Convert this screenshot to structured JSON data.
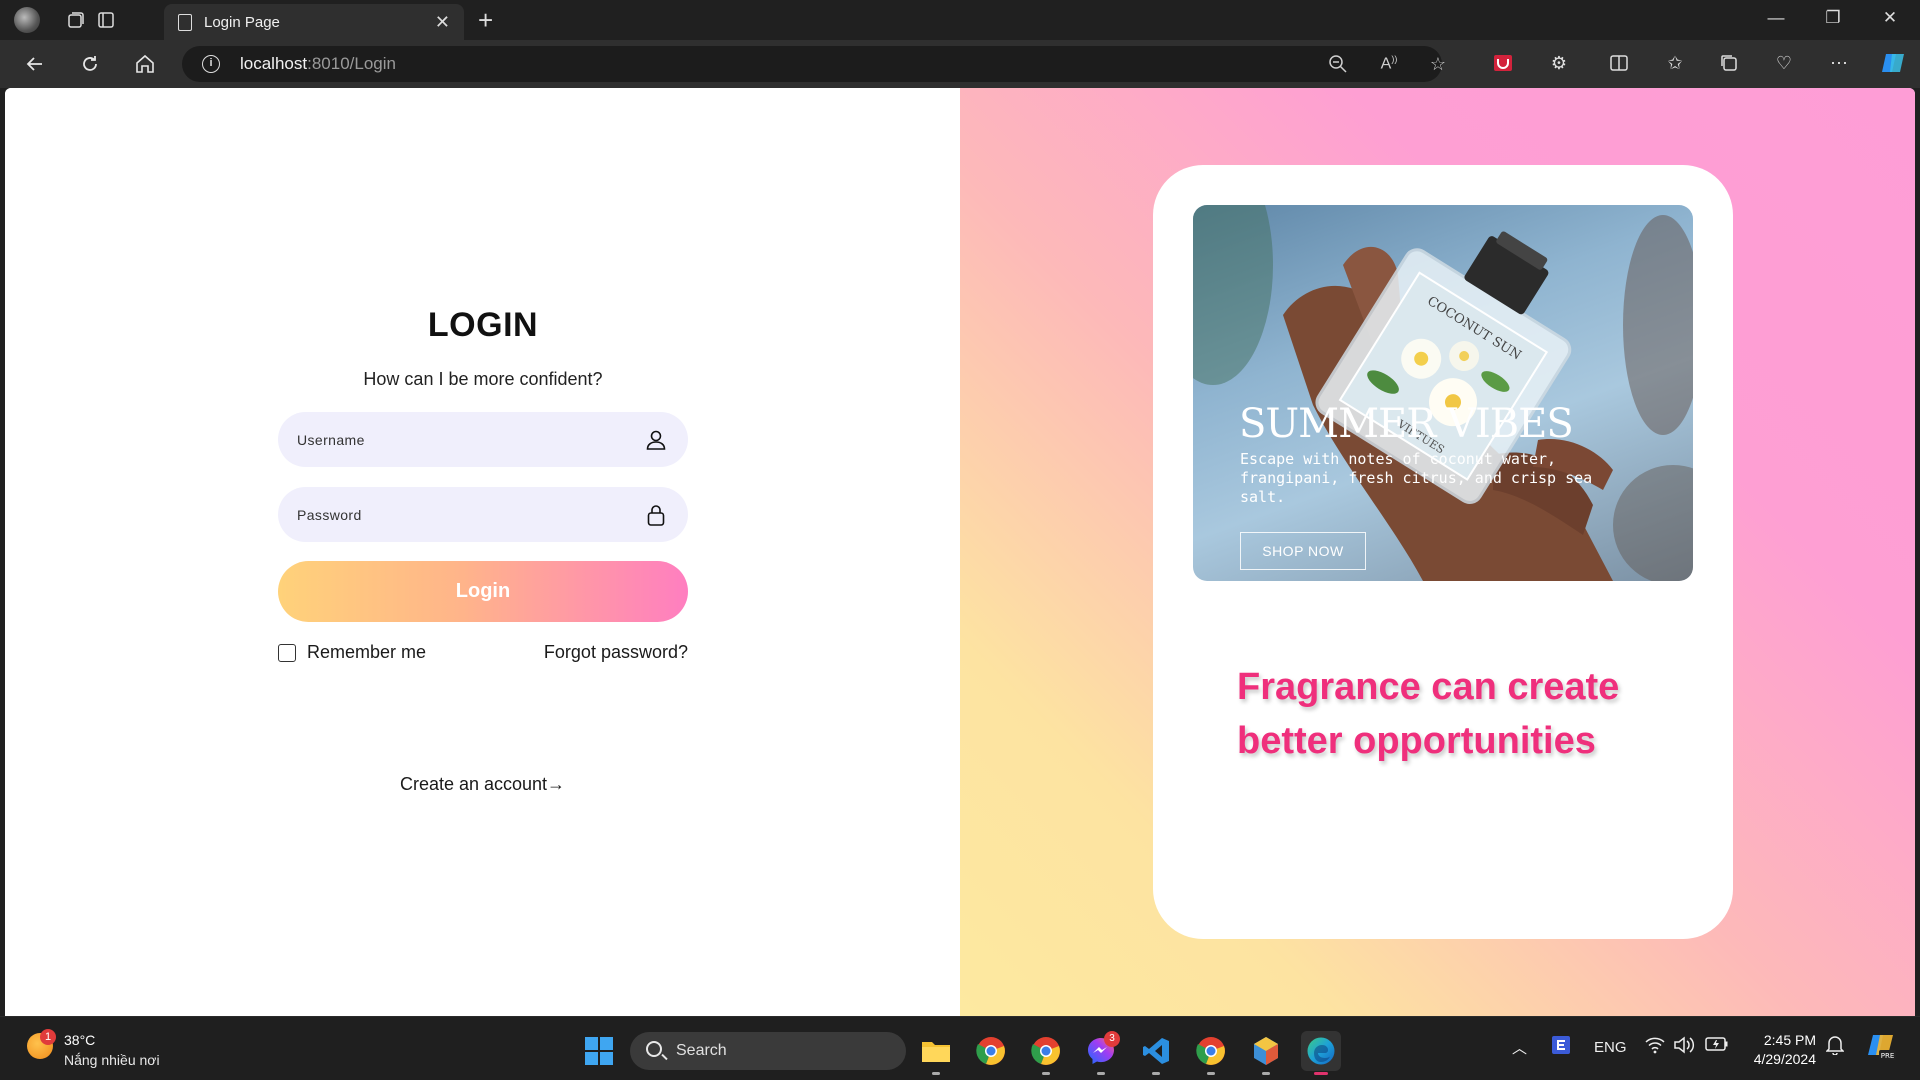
{
  "browser": {
    "tab_title": "Login Page",
    "url_host": "localhost",
    "url_rest": ":8010/Login"
  },
  "login": {
    "title": "LOGIN",
    "subtitle": "How can I be more confident?",
    "username_placeholder": "Username",
    "password_placeholder": "Password",
    "login_button": "Login",
    "remember_me": "Remember me",
    "forgot_password": "Forgot password?",
    "create_account": "Create an account"
  },
  "promo": {
    "bottle_brand": "COCONUT SUN",
    "bottle_sub": "VIRTUES",
    "headline": "SUMMER VIBES",
    "description": "Escape with notes of coconut water, frangipani, fresh citrus, and crisp sea salt.",
    "button": "SHOP NOW",
    "tagline": "Fragrance can create better opportunities"
  },
  "taskbar": {
    "weather_badge": "1",
    "weather_temp": "38°C",
    "weather_desc": "Nắng nhiều nơi",
    "search_label": "Search",
    "messenger_badge": "3",
    "language": "ENG",
    "time": "2:45 PM",
    "date": "4/29/2024",
    "copilot_badge": "PRE"
  },
  "colors": {
    "accent_pink": "#ef2f7c",
    "button_gradient_start": "#ffd27a",
    "button_gradient_end": "#ff7ec0",
    "field_bg": "#f0effc"
  }
}
